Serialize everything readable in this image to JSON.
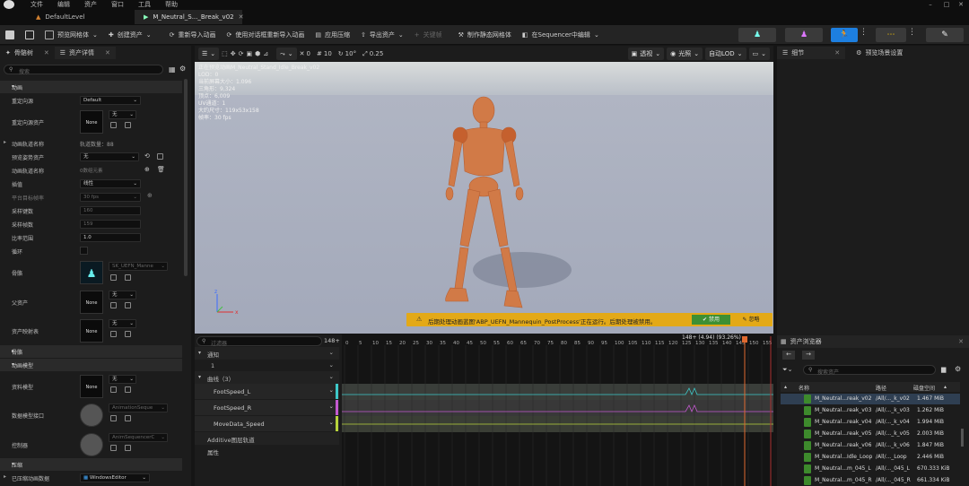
{
  "menu": [
    "文件",
    "编辑",
    "资产",
    "窗口",
    "工具",
    "帮助"
  ],
  "tabs": {
    "level": "DefaultLevel",
    "anim": "M_Neutral_S..._Break_v02"
  },
  "toolbar": {
    "preview_mesh": "预览网格体",
    "create_asset": "创建资产",
    "reimport": "重新导入动画",
    "reimport_dialog": "使用对话框重新导入动画",
    "apply_compress": "应用压缩",
    "export_asset": "导出资产",
    "keyframe": "关键帧",
    "make_static": "制作静态网格体",
    "edit_sequencer": "在Sequencer中编辑"
  },
  "left": {
    "tab_skeleton": "骨骼树",
    "tab_details": "资产详情",
    "search_placeholder": "搜索",
    "sect_anim": "动画",
    "retarget_source": "重定向源",
    "retarget_source_val": "Default",
    "retarget_asset": "重定向源资产",
    "none": "None",
    "none_cn": "无",
    "anim_track_names": "动画轨道名称",
    "track_count": "轨道数量：88",
    "preview_pose": "预览姿势资产",
    "anim_track_name": "动画轨道名称",
    "bone_placeholder": "0数组元素",
    "interp": "插值",
    "interp_val": "线性",
    "platform_rate": "平台目标帧率",
    "platform_rate_val": "30 fps",
    "sample_keys": "采样键数",
    "sample_keys_val": "160",
    "sample_frames": "采样帧数",
    "sample_frames_val": "159",
    "rate_scale": "比率范围",
    "rate_scale_val": "1.0",
    "loop": "循环",
    "skeleton": "骨骼",
    "skeleton_val": "SK_UEFN_Manne",
    "parent_asset": "父资产",
    "asset_mapping": "资产映射表",
    "sect_bones": "骨骼",
    "sect_anim_model": "动画模型",
    "model_asset": "资料模型",
    "data_model_interface": "数据模型接口",
    "data_model_val": "AnimationSeque",
    "controller": "控制器",
    "controller_val": "AnimSequencerC",
    "sect_compression": "压缩",
    "compressed_data": "已压缩动画数据",
    "compressed_data_val": "WindowsEditor"
  },
  "viewport": {
    "perspective": "透视",
    "lit": "光照",
    "auto_lod": "自动LOD",
    "snap_1": "0",
    "snap_2": "10",
    "snap_3": "10°",
    "snap_4": "0.25",
    "stats": [
      "正在预览动画M_Neutral_Stand_Idle_Break_v02",
      "LOD：0",
      "当前屏幕大小：1.096",
      "三角形：9,324",
      "顶点：6,009",
      "UV通道：1",
      "大约尺寸：119x53x158",
      "帧率：30 fps"
    ]
  },
  "notify": {
    "message": "后期处理动画蓝图'ABP_UEFN_Mannequin_PostProcess'正在运行。后期处理被禁用。",
    "apply": "禁用",
    "ignore": "忽略"
  },
  "timeline": {
    "filter_placeholder": "过滤器",
    "counter": "148",
    "notifies": "通知",
    "notify_index": "1",
    "curves": "曲线（3）",
    "curve1": "FootSpeed_L",
    "curve2": "FootSpeed_R",
    "curve3": "MoveData_Speed",
    "additive": "Additive图层轨道",
    "attributes": "属性",
    "playhead": "148+ (4.94) (93.26%)",
    "ticks": [
      "0",
      "5",
      "10",
      "15",
      "20",
      "25",
      "30",
      "35",
      "40",
      "45",
      "50",
      "55",
      "60",
      "65",
      "70",
      "75",
      "80",
      "85",
      "90",
      "95",
      "100",
      "105",
      "110",
      "115",
      "120",
      "125",
      "130",
      "135",
      "140",
      "145",
      "150",
      "155"
    ]
  },
  "right": {
    "details": "细节",
    "preview_settings": "预览场景设置",
    "asset_browser": "资产浏览器",
    "search_placeholder": "搜索资产",
    "col_name": "名称",
    "col_path": "路径",
    "col_size": "磁盘空间",
    "assets": [
      {
        "name": "M_Neutral...reak_v02",
        "path": "/All/..._k_v02",
        "size": "1.467 MiB"
      },
      {
        "name": "M_Neutral...reak_v03",
        "path": "/All/..._k_v03",
        "size": "1.262 MiB"
      },
      {
        "name": "M_Neutral...reak_v04",
        "path": "/All/..._k_v04",
        "size": "1.994 MiB"
      },
      {
        "name": "M_Neutral...reak_v05",
        "path": "/All/..._k_v05",
        "size": "2.003 MiB"
      },
      {
        "name": "M_Neutral...reak_v06",
        "path": "/All/..._k_v06",
        "size": "1.847 MiB"
      },
      {
        "name": "M_Neutral...Idle_Loop",
        "path": "/All/..._Loop",
        "size": "2.446 MiB"
      },
      {
        "name": "M_Neutral...m_045_L",
        "path": "/All/..._045_L",
        "size": "670.333 KiB"
      },
      {
        "name": "M_Neutral...m_045_R",
        "path": "/All/..._045_R",
        "size": "661.334 KiB"
      }
    ]
  }
}
